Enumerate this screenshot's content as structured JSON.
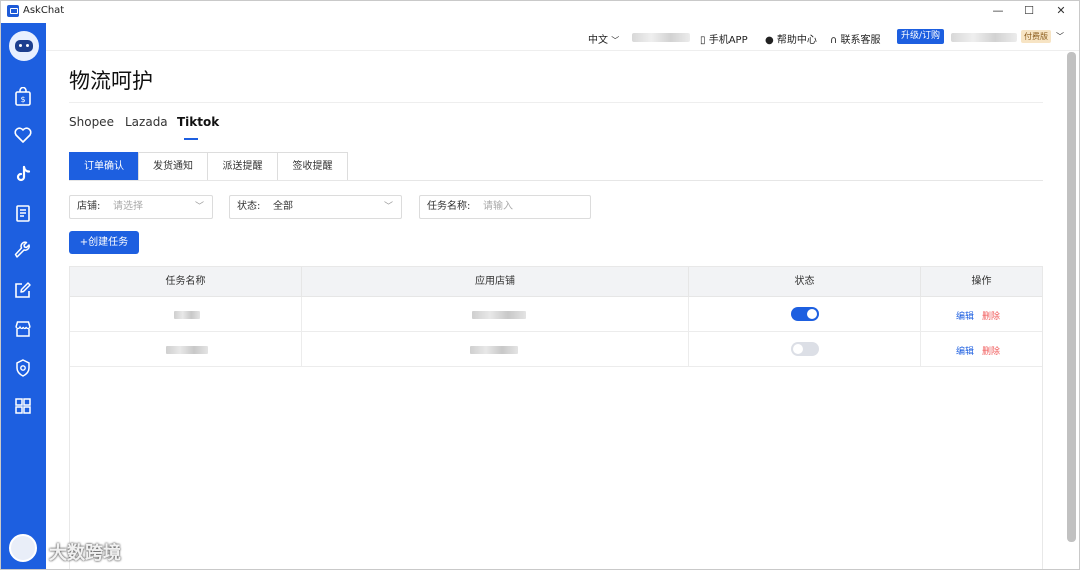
{
  "app": {
    "title": "AskChat",
    "win_min": "—",
    "win_max": "☐",
    "win_close": "✕"
  },
  "header": {
    "language": "中文",
    "mobile_app": "手机APP",
    "help_center": "帮助中心",
    "contact_support": "联系客服",
    "upgrade": "升级/订购",
    "plan_badge": "付费版"
  },
  "sidebar": {
    "items": [
      {
        "icon": "shopping-bag-icon"
      },
      {
        "icon": "heart-icon"
      },
      {
        "icon": "tiktok-icon"
      },
      {
        "icon": "document-icon"
      },
      {
        "icon": "wrench-icon"
      },
      {
        "icon": "edit-icon"
      },
      {
        "icon": "store-icon"
      },
      {
        "icon": "shield-icon"
      },
      {
        "icon": "grid-icon"
      }
    ],
    "active_color": "#1d5fe0"
  },
  "page": {
    "title": "物流呵护"
  },
  "platform_tabs": [
    {
      "label": "Shopee",
      "active": false
    },
    {
      "label": "Lazada",
      "active": false
    },
    {
      "label": "Tiktok",
      "active": true
    }
  ],
  "sub_tabs": [
    {
      "label": "订单确认",
      "active": true
    },
    {
      "label": "发货通知",
      "active": false
    },
    {
      "label": "派送提醒",
      "active": false
    },
    {
      "label": "签收提醒",
      "active": false
    }
  ],
  "filters": {
    "store_label": "店铺:",
    "store_placeholder": "请选择",
    "status_label": "状态:",
    "status_value": "全部",
    "task_name_label": "任务名称:",
    "task_name_placeholder": "请输入"
  },
  "create_button": "+创建任务",
  "table": {
    "columns": [
      "任务名称",
      "应用店铺",
      "状态",
      "操作"
    ],
    "rows": [
      {
        "status_on": true,
        "edit": "编辑",
        "delete": "删除"
      },
      {
        "status_on": false,
        "edit": "编辑",
        "delete": "删除"
      }
    ]
  },
  "watermark": {
    "text": "大数跨境"
  },
  "colors": {
    "primary": "#1d5fe0",
    "danger": "#f05a5a"
  }
}
